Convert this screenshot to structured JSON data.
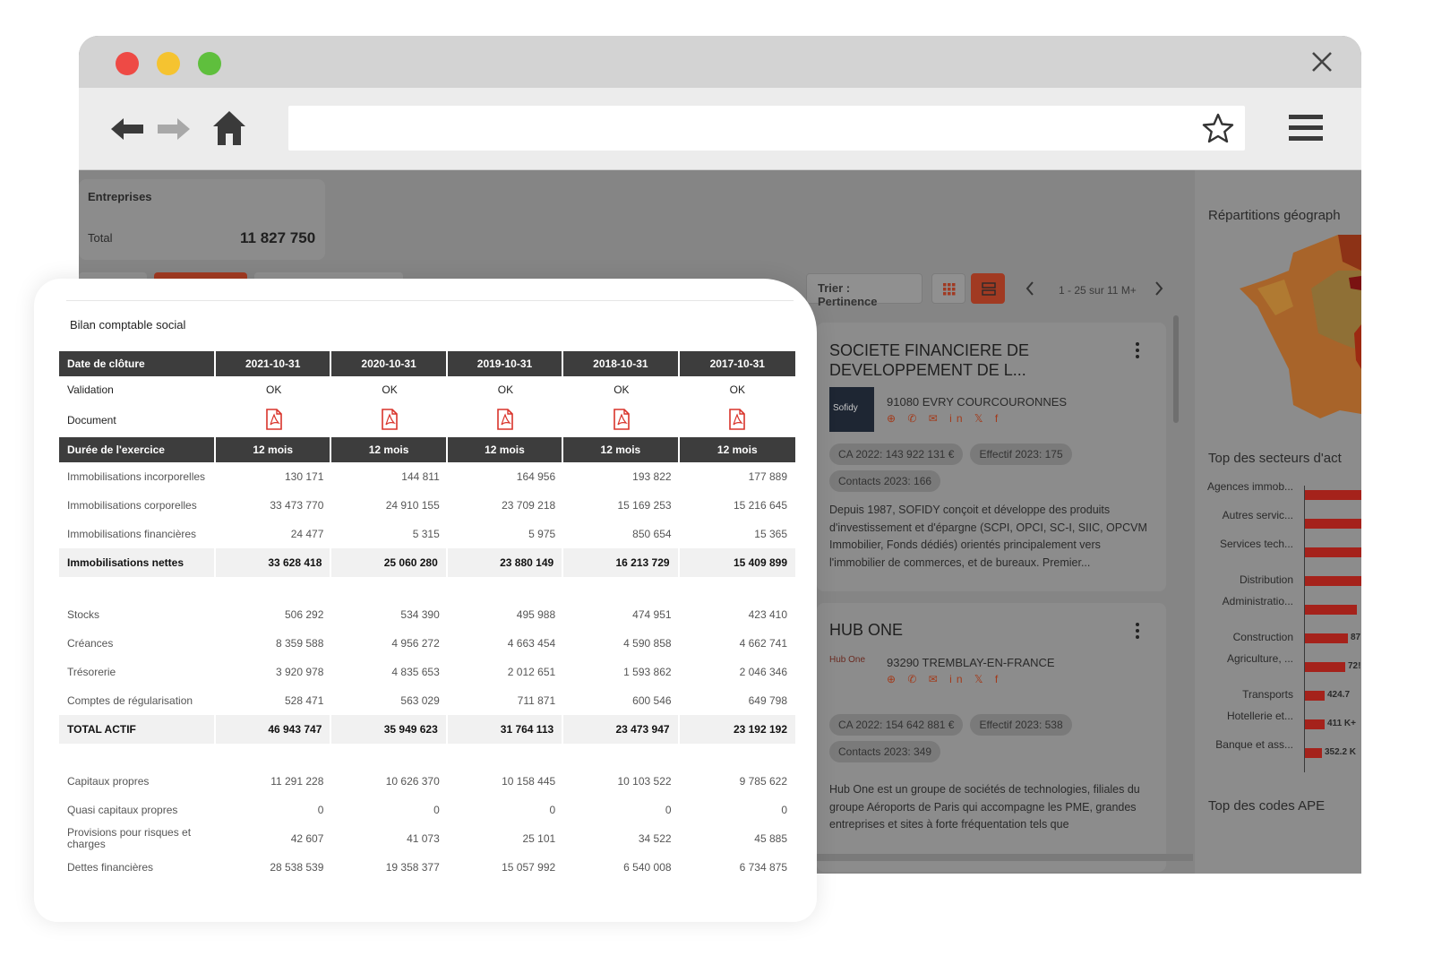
{
  "browser": {
    "address": "",
    "buttons": {
      "back": "back-arrow-icon",
      "forward": "forward-arrow-icon",
      "home": "home-icon",
      "bookmark": "star-icon",
      "menu": "hamburger-menu-icon",
      "close": "close-icon"
    },
    "traffic_lights": {
      "red": "#ee4a45",
      "yellow": "#f5c330",
      "green": "#5fbf3d"
    }
  },
  "app": {
    "summary": {
      "title": "Entreprises",
      "total_label": "Total",
      "total_value": "11 827 750"
    },
    "sort_label": "Trier : Pertinence",
    "pagination": "1 - 25 sur 11 M+",
    "accent_color": "#c0392b",
    "results": [
      {
        "name": "SOCIETE FINANCIERE DE DEVELOPPEMENT DE L...",
        "logo": "Sofidy",
        "address": "91080 EVRY COURCOURONNES",
        "chips": [
          "CA 2022:  143 922 131 €",
          "Effectif 2023:  175",
          "Contacts 2023:  166"
        ],
        "description": "Depuis 1987, SOFIDY conçoit et développe des produits d'investissement et d'épargne (SCPI, OPCI, SC-I, SIIC, OPCVM Immobilier, Fonds dédiés) orientés principalement vers l'immobilier de commerces, et de bureaux. Premier..."
      },
      {
        "name": "HUB ONE",
        "logo": "Hub One",
        "address": "93290 TREMBLAY-EN-FRANCE",
        "chips": [
          "CA 2022:  154 642 881 €",
          "Effectif 2023:  538",
          "Contacts 2023:  349"
        ],
        "description": "Hub One est un groupe de sociétés de technologies, filiales du groupe Aéroports de Paris qui accompagne les PME, grandes entreprises et sites à forte fréquentation tels que"
      }
    ],
    "right_panel": {
      "geo_title": "Répartitions géograph",
      "sectors_title": "Top des secteurs d'act",
      "ape_title": "Top des codes APE",
      "sectors": [
        {
          "label": "Agences immob...",
          "value": "",
          "level": 1.0
        },
        {
          "label": "Autres servic...",
          "value": "",
          "level": 1.0
        },
        {
          "label": "Services tech...",
          "value": "",
          "level": 1.0
        },
        {
          "label": "Distribution",
          "value": "",
          "level": 1.0
        },
        {
          "label": "Administratio...",
          "value": "",
          "level": 0.9
        },
        {
          "label": "Construction",
          "value": "87",
          "level": 0.75
        },
        {
          "label": "Agriculture, ...",
          "value": "72!",
          "level": 0.7
        },
        {
          "label": "Transports",
          "value": "424.7",
          "level": 0.35
        },
        {
          "label": "Hotellerie et...",
          "value": "411 K+",
          "level": 0.34
        },
        {
          "label": "Banque et ass...",
          "value": "352.2 K",
          "level": 0.3
        }
      ]
    }
  },
  "financials": {
    "title": "Bilan comptable social",
    "header_label": "Date de clôture",
    "years": [
      "2021-10-31",
      "2020-10-31",
      "2019-10-31",
      "2018-10-31",
      "2017-10-31"
    ],
    "validation_label": "Validation",
    "validation": [
      "OK",
      "OK",
      "OK",
      "OK",
      "OK"
    ],
    "document_label": "Document",
    "document_icon": "pdf-icon",
    "duration_label": "Durée de l'exercice",
    "durations": [
      "12 mois",
      "12 mois",
      "12 mois",
      "12 mois",
      "12 mois"
    ],
    "rows_a": [
      {
        "label": "Immobilisations incorporelles",
        "values": [
          "130 171",
          "144 811",
          "164 956",
          "193 822",
          "177 889"
        ]
      },
      {
        "label": "Immobilisations corporelles",
        "values": [
          "33 473 770",
          "24 910 155",
          "23 709 218",
          "15 169 253",
          "15 216 645"
        ]
      },
      {
        "label": "Immobilisations financières",
        "values": [
          "24 477",
          "5 315",
          "5 975",
          "850 654",
          "15 365"
        ]
      }
    ],
    "total_a": {
      "label": "Immobilisations nettes",
      "values": [
        "33 628 418",
        "25 060 280",
        "23 880 149",
        "16 213 729",
        "15 409 899"
      ]
    },
    "rows_b": [
      {
        "label": "Stocks",
        "values": [
          "506 292",
          "534 390",
          "495 988",
          "474 951",
          "423 410"
        ]
      },
      {
        "label": "Créances",
        "values": [
          "8 359 588",
          "4 956 272",
          "4 663 454",
          "4 590 858",
          "4 662 741"
        ]
      },
      {
        "label": "Trésorerie",
        "values": [
          "3 920 978",
          "4 835 653",
          "2 012 651",
          "1 593 862",
          "2 046 346"
        ]
      },
      {
        "label": "Comptes de régularisation",
        "values": [
          "528 471",
          "563 029",
          "711 871",
          "600 546",
          "649 798"
        ]
      }
    ],
    "total_b": {
      "label": "TOTAL ACTIF",
      "values": [
        "46 943 747",
        "35 949 623",
        "31 764 113",
        "23 473 947",
        "23 192 192"
      ]
    },
    "rows_c": [
      {
        "label": "Capitaux propres",
        "values": [
          "11 291 228",
          "10 626 370",
          "10 158 445",
          "10 103 522",
          "9 785 622"
        ]
      },
      {
        "label": "Quasi capitaux propres",
        "values": [
          "0",
          "0",
          "0",
          "0",
          "0"
        ]
      },
      {
        "label": "Provisions pour risques et charges",
        "values": [
          "42 607",
          "41 073",
          "25 101",
          "34 522",
          "45 885"
        ]
      },
      {
        "label": "Dettes financières",
        "values": [
          "28 538 539",
          "19 358 377",
          "15 057 992",
          "6 540 008",
          "6 734 875"
        ]
      }
    ]
  }
}
